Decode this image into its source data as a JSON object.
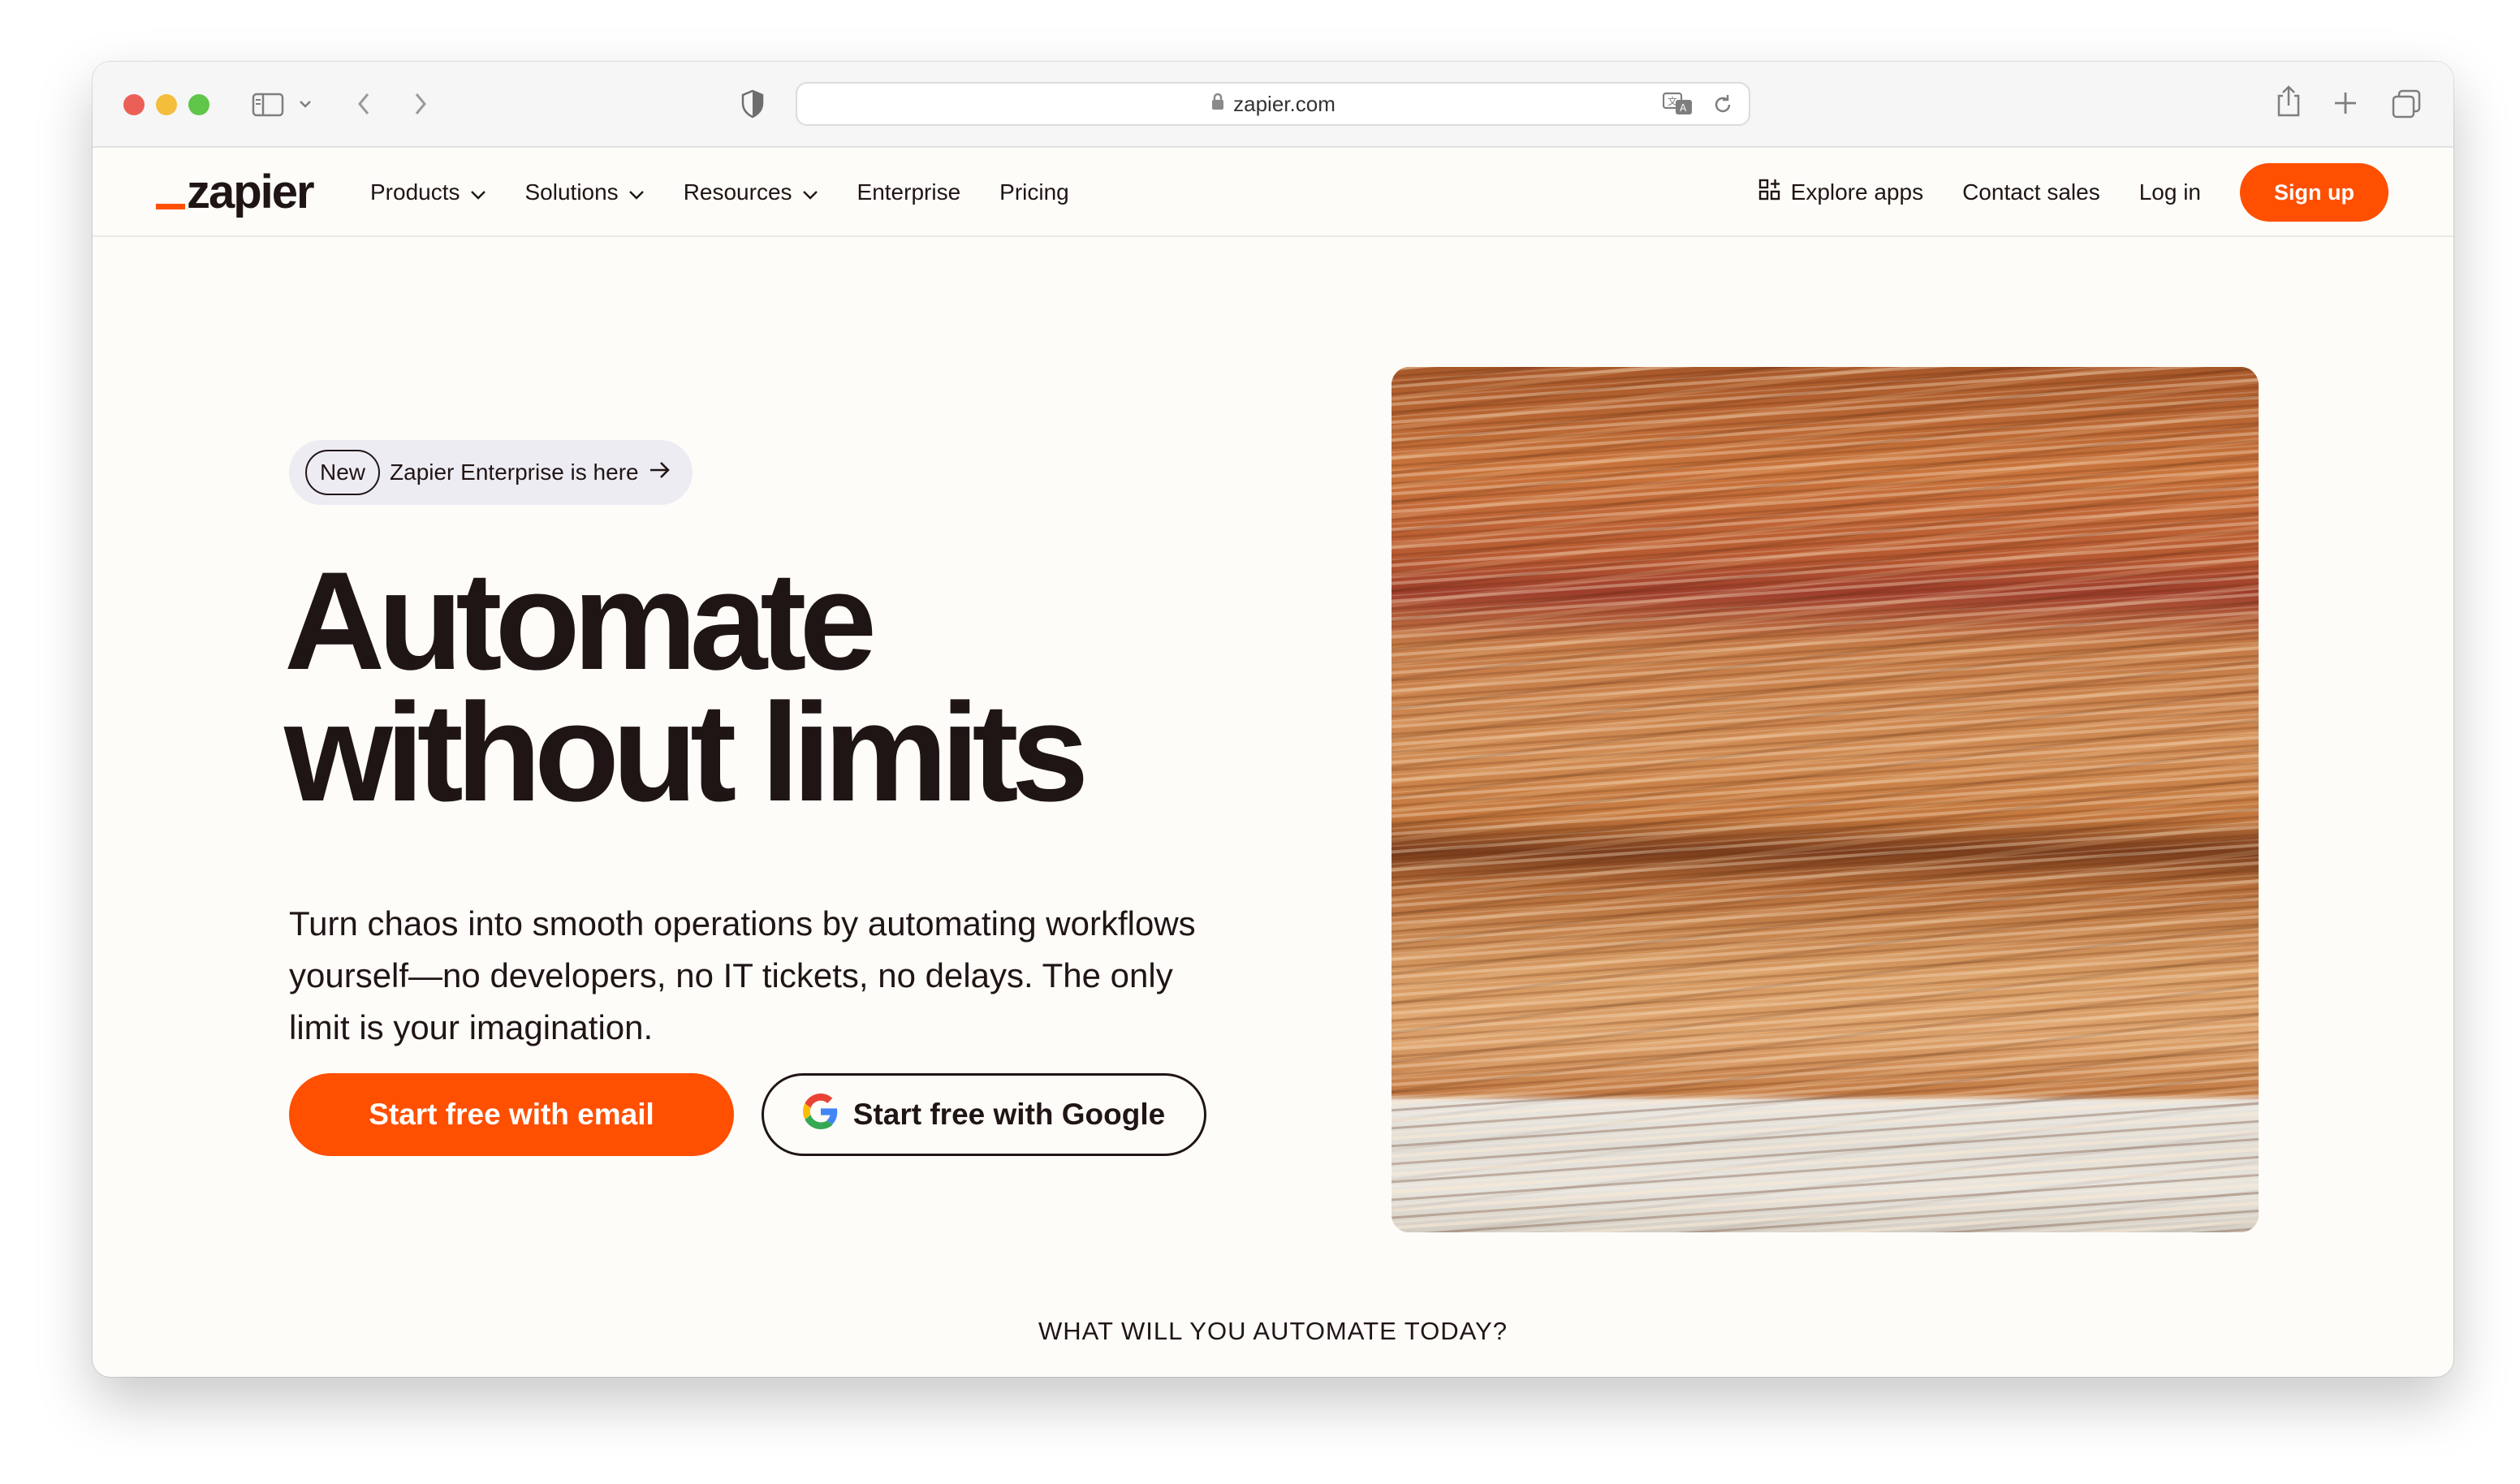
{
  "browser": {
    "url": "zapier.com",
    "icons": [
      "sidebar-icon",
      "chevron-down-icon",
      "back-arrow-icon",
      "forward-arrow-icon",
      "shield-icon",
      "lock-icon",
      "translate-icon",
      "reload-icon",
      "share-icon",
      "new-tab-icon",
      "tabs-overview-icon"
    ]
  },
  "header": {
    "logo": "zapier",
    "nav": [
      {
        "label": "Products",
        "dropdown": true
      },
      {
        "label": "Solutions",
        "dropdown": true
      },
      {
        "label": "Resources",
        "dropdown": true
      },
      {
        "label": "Enterprise",
        "dropdown": false
      },
      {
        "label": "Pricing",
        "dropdown": false
      }
    ],
    "explore_apps": "Explore apps",
    "contact_sales": "Contact sales",
    "login": "Log in",
    "signup": "Sign up"
  },
  "hero": {
    "badge_tag": "New",
    "badge_text": "Zapier Enterprise is here",
    "title_line1": "Automate",
    "title_line2": "without limits",
    "subtitle": "Turn chaos into smooth operations by automating workflows yourself—no developers, no IT tickets, no delays. The only limit is your imagination.",
    "cta_email": "Start free with email",
    "cta_google": "Start free with Google"
  },
  "section": {
    "automate_label": "WHAT WILL YOU AUTOMATE TODAY?"
  },
  "colors": {
    "brand_orange": "#ff4f00",
    "ink": "#201515",
    "page_bg": "#fdfcf8",
    "badge_bg": "#eeecf3"
  }
}
